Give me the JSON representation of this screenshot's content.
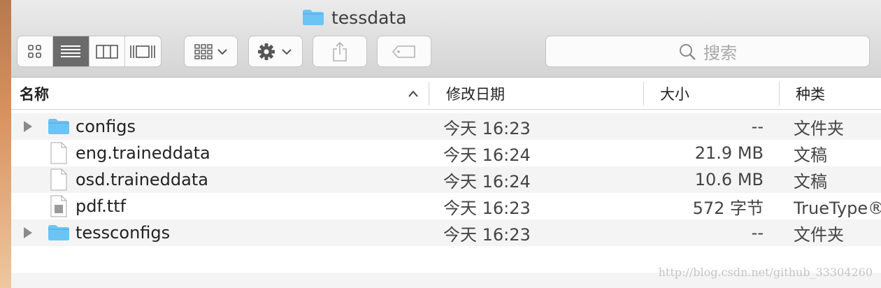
{
  "window": {
    "title": "tessdata"
  },
  "toolbar": {
    "view_modes": [
      "icon-view",
      "list-view",
      "column-view",
      "cover-flow-view"
    ],
    "active_view": "list-view",
    "search_placeholder": "搜索"
  },
  "columns": {
    "name": "名称",
    "date": "修改日期",
    "size": "大小",
    "kind": "种类",
    "sort_indicator": "^"
  },
  "rows": [
    {
      "name": "configs",
      "date": "今天 16:23",
      "size": "--",
      "kind": "文件夹",
      "icon": "folder-icon",
      "expandable": true
    },
    {
      "name": "eng.traineddata",
      "date": "今天 16:24",
      "size": "21.9 MB",
      "kind": "文稿",
      "icon": "document-icon",
      "expandable": false
    },
    {
      "name": "osd.traineddata",
      "date": "今天 16:24",
      "size": "10.6 MB",
      "kind": "文稿",
      "icon": "document-icon",
      "expandable": false
    },
    {
      "name": "pdf.ttf",
      "date": "今天 16:23",
      "size": "572 字节",
      "kind": "TrueType® 字",
      "icon": "font-file-icon",
      "expandable": false
    },
    {
      "name": "tessconfigs",
      "date": "今天 16:23",
      "size": "--",
      "kind": "文件夹",
      "icon": "folder-icon",
      "expandable": true
    }
  ],
  "watermark": "http://blog.csdn.net/github_33304260",
  "colors": {
    "folder": "#6cc4f5",
    "active_segment": "#6b6b6b",
    "alt_row": "#f4f4f4"
  }
}
